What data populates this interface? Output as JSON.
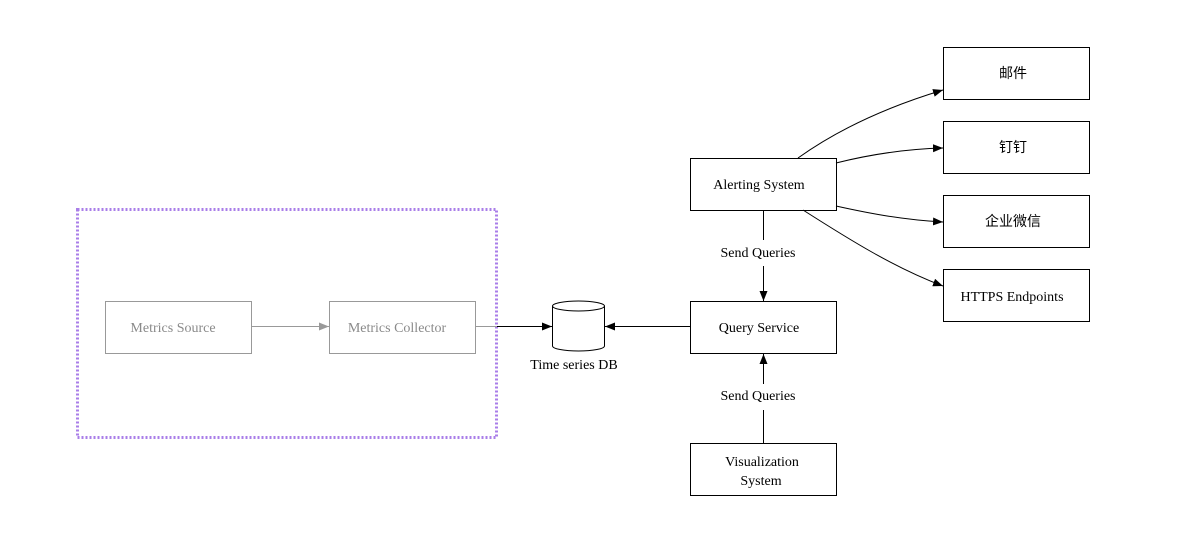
{
  "colors": {
    "group_border": "#a97ee8",
    "inactive": "#8a8a8a",
    "active": "#000000"
  },
  "nodes": {
    "metrics_source": "Metrics Source",
    "metrics_collector": "Metrics Collector",
    "tsdb": "Time series DB",
    "query_service": "Query Service",
    "alerting_system": "Alerting System",
    "visualization_line1": "Visualization",
    "visualization_line2": "System",
    "email": "邮件",
    "dingtalk": "钉钉",
    "wecom": "企业微信",
    "https": "HTTPS Endpoints"
  },
  "edges": {
    "alerting_to_query": "Send Queries",
    "visualization_to_query": "Send Queries"
  }
}
